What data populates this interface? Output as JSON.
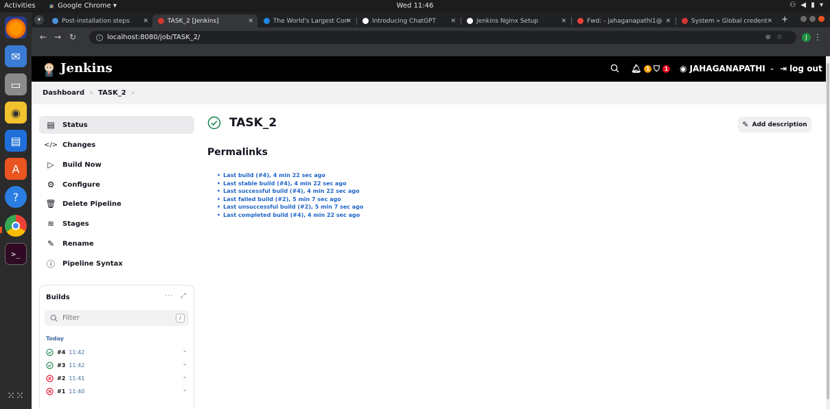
{
  "os": {
    "activities": "Activities",
    "app_name": "Google Chrome ▾",
    "clock": "Wed 11:46"
  },
  "browser": {
    "tabs": [
      {
        "label": "Post-installation steps",
        "color": "#4a90d9"
      },
      {
        "label": "TASK_2 [Jenkins]",
        "color": "#d33833"
      },
      {
        "label": "The World's Largest Con",
        "color": "#1e88e5"
      },
      {
        "label": "Introducing ChatGPT",
        "color": "#ffffff"
      },
      {
        "label": "Jenkins Nginx Setup",
        "color": "#ffffff"
      },
      {
        "label": "Fwd: - jahaganapathi1@",
        "color": "#ea4335"
      },
      {
        "label": "System » Global credent",
        "color": "#d33833"
      }
    ],
    "url": "localhost:8080/job/TASK_2/",
    "profile_initial": "J"
  },
  "jenkins": {
    "brand": "Jenkins",
    "notifications_count": "1",
    "security_count": "1",
    "user": "JAHAGANAPATHI",
    "logout": "log out",
    "colors": {
      "warning": "#fe9c00",
      "danger": "#e6001f",
      "success": "#138347",
      "link": "#1e64c8"
    }
  },
  "breadcrumb": {
    "dashboard": "Dashboard",
    "job": "TASK_2"
  },
  "sidebar": {
    "items": [
      {
        "label": "Status",
        "icon": "document-icon"
      },
      {
        "label": "Changes",
        "icon": "code-icon"
      },
      {
        "label": "Build Now",
        "icon": "play-icon"
      },
      {
        "label": "Configure",
        "icon": "gear-icon"
      },
      {
        "label": "Delete Pipeline",
        "icon": "trash-icon"
      },
      {
        "label": "Stages",
        "icon": "layers-icon"
      },
      {
        "label": "Rename",
        "icon": "pencil-icon"
      },
      {
        "label": "Pipeline Syntax",
        "icon": "help-icon"
      }
    ]
  },
  "builds": {
    "title": "Builds",
    "filter_placeholder": "Filter",
    "filter_shortcut": "/",
    "group": "Today",
    "rows": [
      {
        "number": "#4",
        "time": "11:42",
        "status": "success"
      },
      {
        "number": "#3",
        "time": "11:42",
        "status": "success"
      },
      {
        "number": "#2",
        "time": "11:41",
        "status": "failed"
      },
      {
        "number": "#1",
        "time": "11:40",
        "status": "failed"
      }
    ]
  },
  "main": {
    "title": "TASK_2",
    "add_description": "Add description",
    "permalinks_title": "Permalinks",
    "permalinks": [
      "Last build (#4), 4 min 22 sec ago",
      "Last stable build (#4), 4 min 22 sec ago",
      "Last successful build (#4), 4 min 22 sec ago",
      "Last failed build (#2), 5 min 7 sec ago",
      "Last unsuccessful build (#2), 5 min 7 sec ago",
      "Last completed build (#4), 4 min 22 sec ago"
    ]
  }
}
